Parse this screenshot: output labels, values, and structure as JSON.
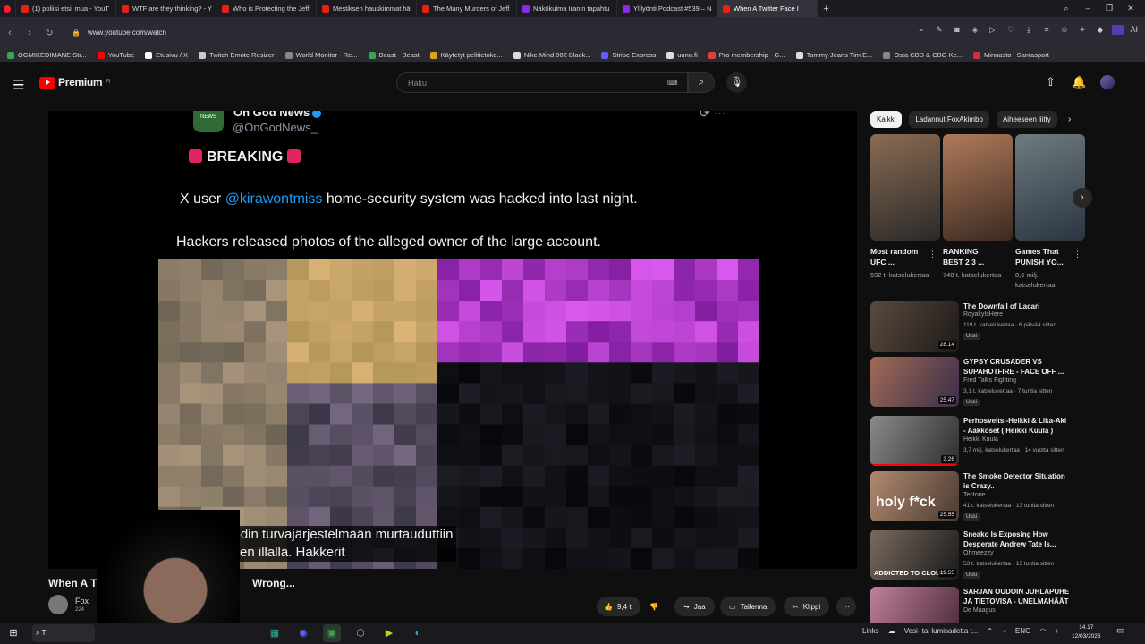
{
  "browser": {
    "tabs": [
      {
        "label": "(1) poliisi etsii mua - YouT",
        "active": false
      },
      {
        "label": "WTF are they thinking? - Y",
        "active": false
      },
      {
        "label": "Who is Protecting the Jeff",
        "active": false
      },
      {
        "label": "Mestiksen hauskimmat hä",
        "active": false
      },
      {
        "label": "The Many Murders of Jeff",
        "active": false
      },
      {
        "label": "Näkökulma Iranin tapahtu",
        "active": false
      },
      {
        "label": "Ylilyönti Podcast #539 – N",
        "active": false
      },
      {
        "label": "When A Twitter Face I",
        "active": true
      }
    ],
    "new_tab": "+",
    "url": "www.youtube.com/watch",
    "ai_label": "AI",
    "bookmarks": [
      {
        "label": "OGMIKEDIMANE Str...",
        "color": "#3aa655"
      },
      {
        "label": "YouTube",
        "color": "#ff0000"
      },
      {
        "label": "Etusivu / X",
        "color": "#ffffff"
      },
      {
        "label": "Twitch Emote Resizer",
        "color": "#cccccc"
      },
      {
        "label": "World Monitor - Re...",
        "color": "#888888"
      },
      {
        "label": "Beast - Beast",
        "color": "#3aa655"
      },
      {
        "label": "Käytetyt pelitietoko...",
        "color": "#e0a020"
      },
      {
        "label": "Nike Mind 002 Black...",
        "color": "#dddddd"
      },
      {
        "label": "Stripe Express",
        "color": "#635bff"
      },
      {
        "label": "uuno.fi",
        "color": "#dddddd"
      },
      {
        "label": "Pro membership - G...",
        "color": "#e04040"
      },
      {
        "label": "Tommy Jeans Tim E...",
        "color": "#dddddd"
      },
      {
        "label": "Osta CBD & CBG Ke...",
        "color": "#888888"
      },
      {
        "label": "Minnasto | Santasport",
        "color": "#d03040"
      }
    ]
  },
  "youtube": {
    "logo_text": "Premium",
    "logo_sup": "FI",
    "search_placeholder": "Haku",
    "accent": "#ff0000"
  },
  "video": {
    "tweet_name": "On God News",
    "tweet_handle": "@OnGodNews_",
    "breaking": "BREAKING",
    "line1_prefix": "X user ",
    "line1_mention": "@kirawontmiss",
    "line1_suffix": " home-security system was hacked into last night.",
    "line2": "Hackers released photos of the alleged owner of the large account.",
    "caption1": "kodin turvajärjestelmään murtauduttiin",
    "caption2": "eilen illalla. Hakkerit",
    "title_left": "When A T",
    "title_right": "Wrong...",
    "channel_name": "Fox",
    "channel_subs": "224"
  },
  "actions": {
    "likes": "9,4 t.",
    "share": "Jaa",
    "save": "Tallenna",
    "clip": "Klippi"
  },
  "sidebar": {
    "chips": [
      {
        "label": "Kaikki",
        "selected": true
      },
      {
        "label": "Ladannut FoxAkimbo",
        "selected": false
      },
      {
        "label": "Aiheeseen liitty",
        "selected": false
      }
    ],
    "shorts": [
      {
        "title": "Most random UFC ...",
        "views": "592 t. katselukertaa",
        "colors": [
          "#8b6b52",
          "#2a2a2a"
        ]
      },
      {
        "title": "RANKING BEST 2 3 ...",
        "views": "748 t. katselukertaa",
        "colors": [
          "#b07a5a",
          "#3a2a22"
        ]
      },
      {
        "title": "Games That PUNISH YO...",
        "views": "8,6 milj. katselukertaa",
        "colors": [
          "#6f7a80",
          "#2a3540"
        ]
      }
    ],
    "videos": [
      {
        "title": "The Downfall of Lacari",
        "channel": "RoyaltyIsHere",
        "meta": "119 t. katselukertaa · 6 päivää sitten",
        "duration": "28.14",
        "new": "Uusi",
        "colors": [
          "#5a4a3e",
          "#1e1a18"
        ],
        "progress": 0
      },
      {
        "title": "GYPSY CRUSADER VS SUPAHOTFIRE - FACE OFF ...",
        "channel": "Fred Talks Fighting",
        "meta": "3,1 t. katselukertaa · 7 tuntia sitten",
        "duration": "25.47",
        "new": "Uusi",
        "colors": [
          "#a06a55",
          "#3a2e4a"
        ],
        "progress": 0
      },
      {
        "title": "Perhosveitsi-Heikki & Lika-Aki - Aakkoset ( Heikki Kuula )",
        "channel": "Heikki Kuula",
        "meta": "3,7 milj. katselukertaa · 14 vuotta sitten",
        "duration": "3.26",
        "new": "",
        "colors": [
          "#8a8a8a",
          "#2e2e2e"
        ],
        "progress": 1
      },
      {
        "title": "The Smoke Detector Situation is Crazy..",
        "channel": "Tectone",
        "meta": "41 t. katselukertaa · 13 tuntia sitten",
        "duration": "25.55",
        "new": "Uusi",
        "colors": [
          "#b08a70",
          "#4a3a30"
        ],
        "progress": 0
      },
      {
        "title": "Sneako Is Exposing How Desperate Andrew Tate Is...",
        "channel": "Ohmeezzy",
        "meta": "53 t. katselukertaa · 13 tuntia sitten",
        "duration": "19.55",
        "new": "Uusi",
        "colors": [
          "#7a6a5e",
          "#1a1a1a"
        ],
        "progress": 0
      },
      {
        "title": "SARJAN OUDOIN JUHLAPUHE JA TIETOVISA - UNELMAHÄÄT",
        "channel": "De Maagus",
        "meta": "",
        "duration": "",
        "new": "",
        "colors": [
          "#c0809a",
          "#4a2a3a"
        ],
        "progress": 0
      }
    ],
    "thumb_texts": [
      "holy f*ck",
      "ADDICTED TO CLOUT"
    ]
  },
  "taskbar": {
    "search_hint": "T",
    "tray_links": "Links",
    "weather": "Vesi- tai lumisadetta t...",
    "lang": "ENG",
    "time": "14.17",
    "date": "12/03/2026"
  }
}
